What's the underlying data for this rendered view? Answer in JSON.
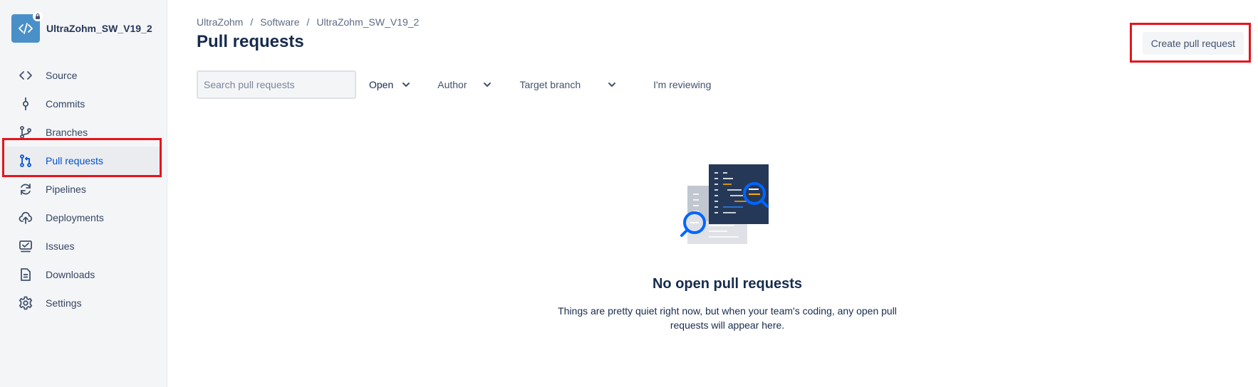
{
  "repo": {
    "name": "UltraZohm_SW_V19_2",
    "avatar_icon": "code-icon",
    "avatar_color": "#4a90c8"
  },
  "sidebar": {
    "items": [
      {
        "label": "Source",
        "icon": "code-brackets-icon"
      },
      {
        "label": "Commits",
        "icon": "commit-icon"
      },
      {
        "label": "Branches",
        "icon": "branch-icon"
      },
      {
        "label": "Pull requests",
        "icon": "pull-request-icon",
        "active": true
      },
      {
        "label": "Pipelines",
        "icon": "pipelines-icon"
      },
      {
        "label": "Deployments",
        "icon": "cloud-upload-icon"
      },
      {
        "label": "Issues",
        "icon": "issues-icon"
      },
      {
        "label": "Downloads",
        "icon": "document-icon"
      },
      {
        "label": "Settings",
        "icon": "gear-icon"
      }
    ]
  },
  "breadcrumb": [
    "UltraZohm",
    "Software",
    "UltraZohm_SW_V19_2"
  ],
  "breadcrumb_separator": "/",
  "page_title": "Pull requests",
  "create_button_label": "Create pull request",
  "filters": {
    "search_placeholder": "Search pull requests",
    "state_label": "Open",
    "author_label": "Author",
    "target_branch_label": "Target branch",
    "reviewing_label": "I'm reviewing"
  },
  "empty_state": {
    "title": "No open pull requests",
    "description": "Things are pretty quiet right now, but when your team's coding, any open pull requests will appear here."
  },
  "colors": {
    "accent": "#0052cc",
    "highlight": "#e5141b",
    "sidebar_bg": "#f4f5f7"
  }
}
